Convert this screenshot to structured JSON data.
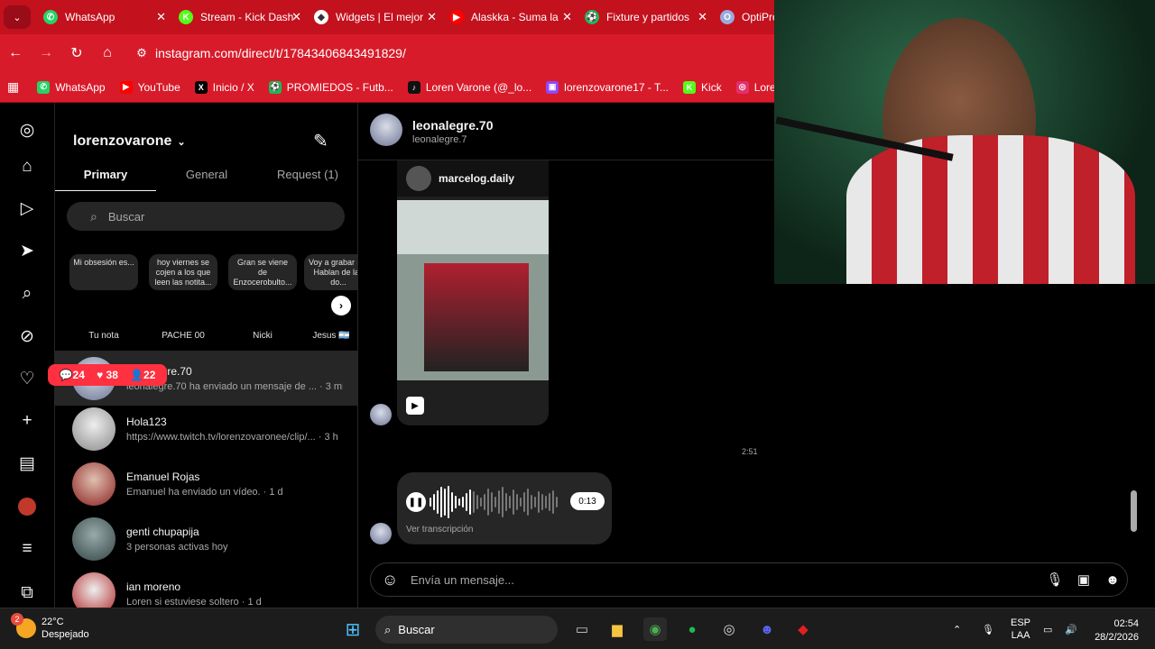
{
  "browser": {
    "tabs": [
      {
        "title": "WhatsApp",
        "color": "#25d366",
        "glyph": "✆"
      },
      {
        "title": "Stream - Kick Dash",
        "color": "#53fc18",
        "glyph": "K"
      },
      {
        "title": "Widgets | El mejor",
        "color": "#ffffff",
        "glyph": "◆"
      },
      {
        "title": "Alaskka - Suma la",
        "color": "#ff0000",
        "glyph": "▶"
      },
      {
        "title": "Fixture y partidos",
        "color": "#1db954",
        "glyph": "⚽"
      },
      {
        "title": "OptiProject",
        "color": "#9ad",
        "glyph": "O"
      }
    ],
    "url": "instagram.com/direct/t/17843406843491829/",
    "bookmarks": [
      {
        "label": "WhatsApp",
        "glyph": "✆",
        "color": "#25d366"
      },
      {
        "label": "YouTube",
        "glyph": "▶",
        "color": "#ff0000"
      },
      {
        "label": "Inicio / X",
        "glyph": "X",
        "color": "#000000"
      },
      {
        "label": "PROMIEDOS - Futb...",
        "glyph": "⚽",
        "color": "#1db954"
      },
      {
        "label": "Loren Varone (@_lo...",
        "glyph": "♪",
        "color": "#111111"
      },
      {
        "label": "lorenzovarone17 - T...",
        "glyph": "▣",
        "color": "#9146ff"
      },
      {
        "label": "Kick",
        "glyph": "K",
        "color": "#53fc18"
      },
      {
        "label": "Lorenzo",
        "glyph": "◎",
        "color": "#e1306c"
      }
    ]
  },
  "inbox": {
    "account": "lorenzovarone",
    "tabs": [
      "Primary",
      "General",
      "Request (1)"
    ],
    "search_placeholder": "Buscar",
    "notes": [
      {
        "text": "Mi obsesión es...",
        "name": "Tu nota"
      },
      {
        "text": "hoy viernes se cojen a los que leen las notita...",
        "name": "PACHE 00"
      },
      {
        "text": "Gran se viene de Enzocerobulto...",
        "name": "Nicki"
      },
      {
        "text": "Voy a grabar de: Hablan de las do...",
        "name": "Jesus 🇦🇷"
      }
    ],
    "threads": [
      {
        "name": "leonalegre.70",
        "preview": "leonalegre.70 ha enviado un mensaje de ... · 3 min"
      },
      {
        "name": "Hola123",
        "preview": "https://www.twitch.tv/lorenzovaronee/clip/... · 3 h"
      },
      {
        "name": "Emanuel Rojas",
        "preview": "Emanuel ha enviado un vídeo. · 1 d"
      },
      {
        "name": "genti chupapija",
        "preview": "3 personas activas hoy"
      },
      {
        "name": "ian moreno",
        "preview": "Loren si estuviese soltero · 1 d"
      }
    ],
    "notif": {
      "comments": "24",
      "likes": "38",
      "follows": "22"
    }
  },
  "chat": {
    "name": "leonalegre.70",
    "username": "leonalegre.7",
    "shared_post_user": "marcelog.daily",
    "timestamp": "2:51",
    "voice_duration": "0:13",
    "voice_transcript": "Ver transcripción",
    "composer_placeholder": "Envía un mensaje..."
  },
  "taskbar": {
    "temp": "22°C",
    "condition": "Despejado",
    "weather_badge": "2",
    "search": "Buscar",
    "lang_top": "ESP",
    "lang_bottom": "LAA",
    "time": "02:54",
    "date": "28/2/2026"
  }
}
